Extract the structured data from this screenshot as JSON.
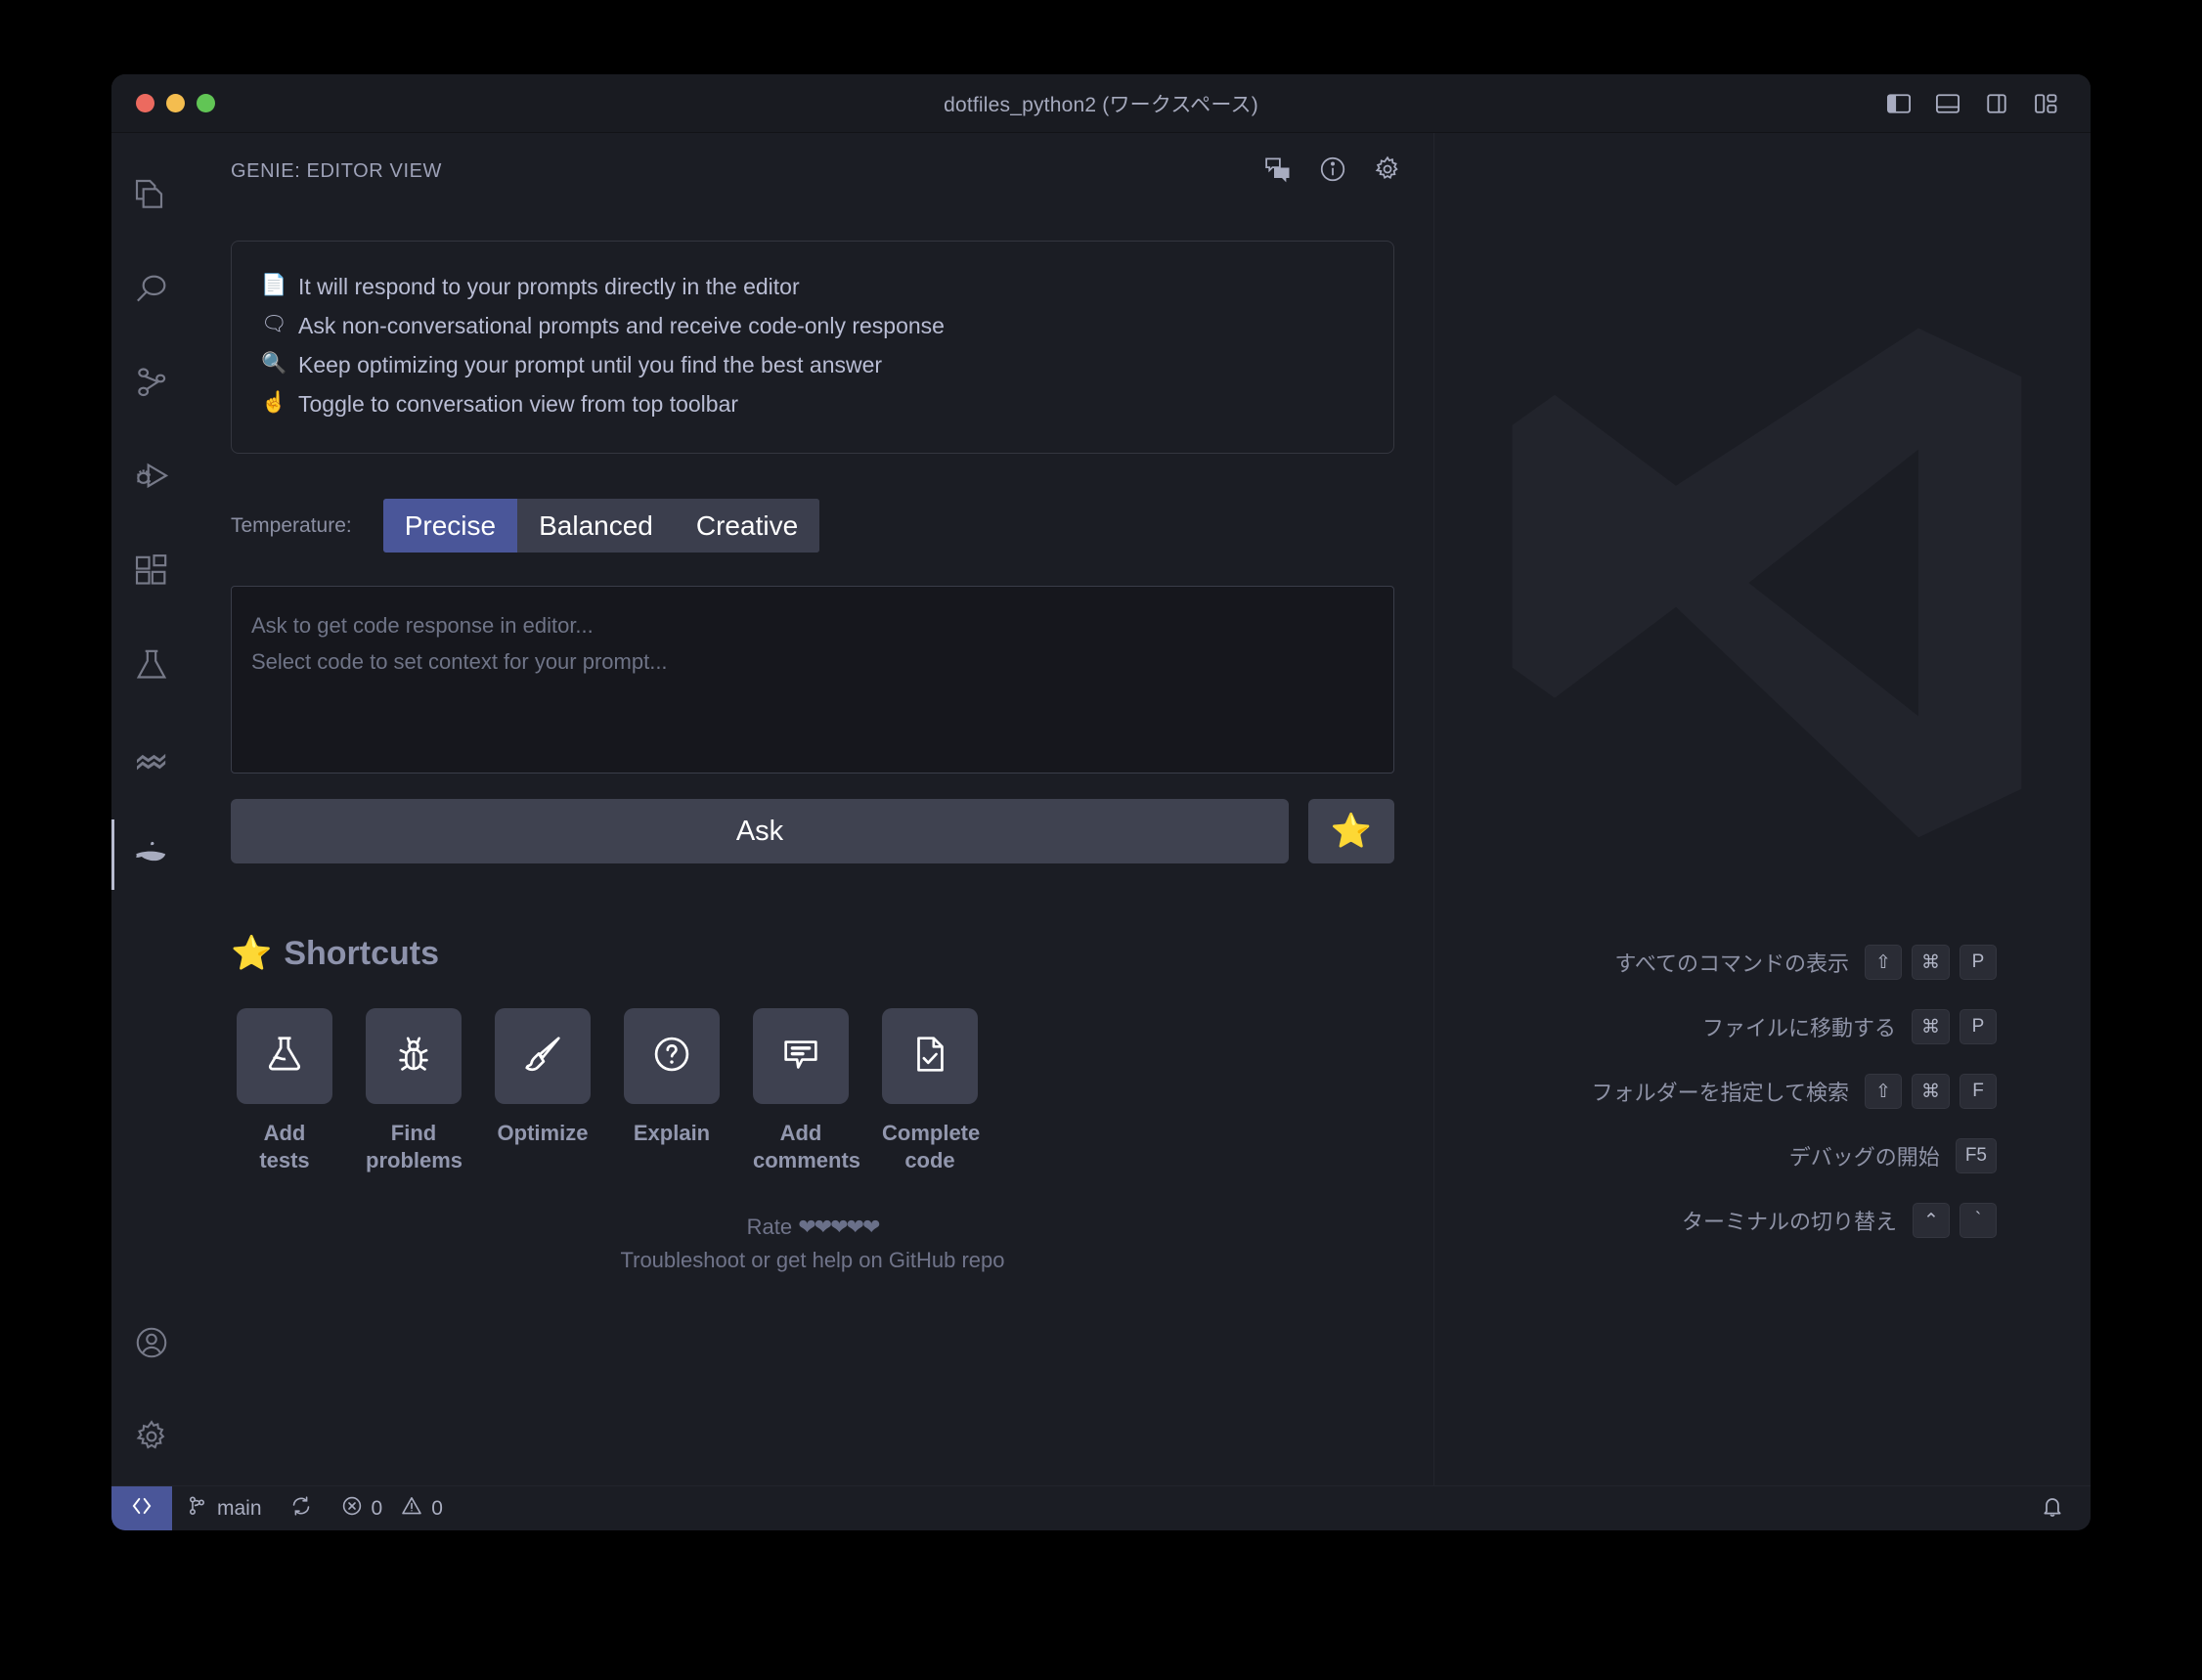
{
  "window": {
    "title": "dotfiles_python2 (ワークスペース)",
    "traffic_lights": [
      "close",
      "minimize",
      "maximize"
    ],
    "layout_icons": [
      "toggle-primary-sidebar",
      "toggle-panel",
      "toggle-secondary-sidebar",
      "customize-layout"
    ]
  },
  "activity_bar": {
    "items": [
      {
        "name": "explorer",
        "icon": "files-icon",
        "active": false
      },
      {
        "name": "search",
        "icon": "search-icon",
        "active": false
      },
      {
        "name": "source-control",
        "icon": "source-control-icon",
        "active": false
      },
      {
        "name": "run-and-debug",
        "icon": "run-debug-icon",
        "active": false
      },
      {
        "name": "extensions",
        "icon": "extensions-icon",
        "active": false
      },
      {
        "name": "testing",
        "icon": "beaker-icon",
        "active": false
      },
      {
        "name": "remote-explorer",
        "icon": "layers-icon",
        "active": false
      },
      {
        "name": "genie",
        "icon": "genie-lamp-icon",
        "active": true
      }
    ],
    "bottom_items": [
      {
        "name": "accounts",
        "icon": "account-icon"
      },
      {
        "name": "manage",
        "icon": "gear-icon"
      }
    ]
  },
  "genie": {
    "header_title": "GENIE: EDITOR VIEW",
    "header_actions": [
      {
        "name": "conversation-view",
        "icon": "comment-discussion-icon"
      },
      {
        "name": "info",
        "icon": "info-icon"
      },
      {
        "name": "settings",
        "icon": "gear-icon"
      }
    ],
    "tips": [
      {
        "emoji": "📄",
        "text": "It will respond to your prompts directly in the editor"
      },
      {
        "emoji": "🗨",
        "text": "Ask non-conversational prompts and receive code-only response"
      },
      {
        "emoji": "🔍",
        "text": "Keep optimizing your prompt until you find the best answer"
      },
      {
        "emoji": "☝",
        "text": "Toggle to conversation view from top toolbar"
      }
    ],
    "temperature": {
      "label": "Temperature:",
      "options": [
        "Precise",
        "Balanced",
        "Creative"
      ],
      "selected": "Precise",
      "selected_color": "#4a5699"
    },
    "prompt": {
      "placeholder_line1": "Ask to get code response in editor...",
      "placeholder_line2": "Select code to set context for your prompt...",
      "value": ""
    },
    "ask_button": "Ask",
    "favorite_button_icon": "⭐",
    "shortcuts_title": "Shortcuts",
    "shortcuts_title_icon": "⭐",
    "shortcuts": [
      {
        "label": "Add tests",
        "icon": "beaker-icon"
      },
      {
        "label": "Find problems",
        "icon": "bug-icon"
      },
      {
        "label": "Optimize",
        "icon": "paintbrush-icon"
      },
      {
        "label": "Explain",
        "icon": "question-circle-icon"
      },
      {
        "label": "Add comments",
        "icon": "comment-icon"
      },
      {
        "label": "Complete code",
        "icon": "file-check-icon"
      }
    ],
    "footer": {
      "rate_label": "Rate",
      "rate_hearts": "❤❤❤❤❤",
      "help_text": "Troubleshoot or get help on GitHub repo"
    }
  },
  "welcome": {
    "shortcuts": [
      {
        "label": "すべてのコマンドの表示",
        "keys": [
          "⇧",
          "⌘",
          "P"
        ]
      },
      {
        "label": "ファイルに移動する",
        "keys": [
          "⌘",
          "P"
        ]
      },
      {
        "label": "フォルダーを指定して検索",
        "keys": [
          "⇧",
          "⌘",
          "F"
        ]
      },
      {
        "label": "デバッグの開始",
        "keys": [
          "F5"
        ]
      },
      {
        "label": "ターミナルの切り替え",
        "keys": [
          "⌃",
          "`"
        ]
      }
    ]
  },
  "status_bar": {
    "remote_icon": "remote-indicator-icon",
    "remote_color": "#4a5699",
    "branch": "main",
    "sync_icon": "sync-icon",
    "errors": "0",
    "warnings": "0",
    "bell_icon": "bell-icon"
  }
}
